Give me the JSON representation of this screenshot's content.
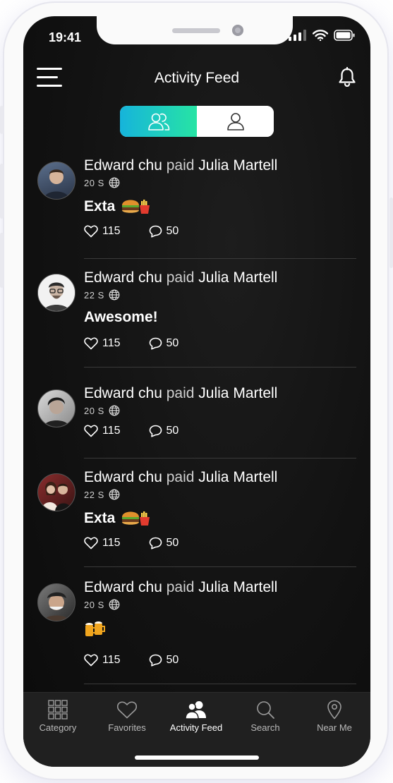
{
  "status_bar": {
    "time": "19:41"
  },
  "header": {
    "title": "Activity Feed"
  },
  "toggle": {
    "active": "group",
    "options": [
      "group-icon",
      "person-icon"
    ]
  },
  "feed": [
    {
      "sender": "Edward chu",
      "verb": "paid",
      "recipient": "Julia Martell",
      "time": "20 S",
      "message": "Exta",
      "emoji": "burger-fries",
      "likes": "115",
      "comments": "50"
    },
    {
      "sender": "Edward chu",
      "verb": "paid",
      "recipient": "Julia Martell",
      "time": "22 S",
      "message": "Awesome!",
      "emoji": "",
      "likes": "115",
      "comments": "50"
    },
    {
      "sender": "Edward chu",
      "verb": "paid",
      "recipient": "Julia Martell",
      "time": "20 S",
      "message": "",
      "emoji": "",
      "likes": "115",
      "comments": "50"
    },
    {
      "sender": "Edward chu",
      "verb": "paid",
      "recipient": "Julia Martell",
      "time": "22 S",
      "message": "Exta",
      "emoji": "burger-fries",
      "likes": "115",
      "comments": "50"
    },
    {
      "sender": "Edward chu",
      "verb": "paid",
      "recipient": "Julia Martell",
      "time": "20 S",
      "message": "",
      "emoji": "beer-mugs",
      "likes": "115",
      "comments": "50"
    }
  ],
  "tabbar": {
    "items": [
      {
        "label": "Category",
        "icon": "grid-icon"
      },
      {
        "label": "Favorites",
        "icon": "heart-icon"
      },
      {
        "label": "Activity Feed",
        "icon": "group-icon",
        "active": true
      },
      {
        "label": "Search",
        "icon": "search-icon"
      },
      {
        "label": "Near Me",
        "icon": "location-pin-icon"
      }
    ]
  },
  "colors": {
    "accent_start": "#16b4db",
    "accent_end": "#27e4a4",
    "background": "#121212",
    "tabbar": "#202020"
  }
}
